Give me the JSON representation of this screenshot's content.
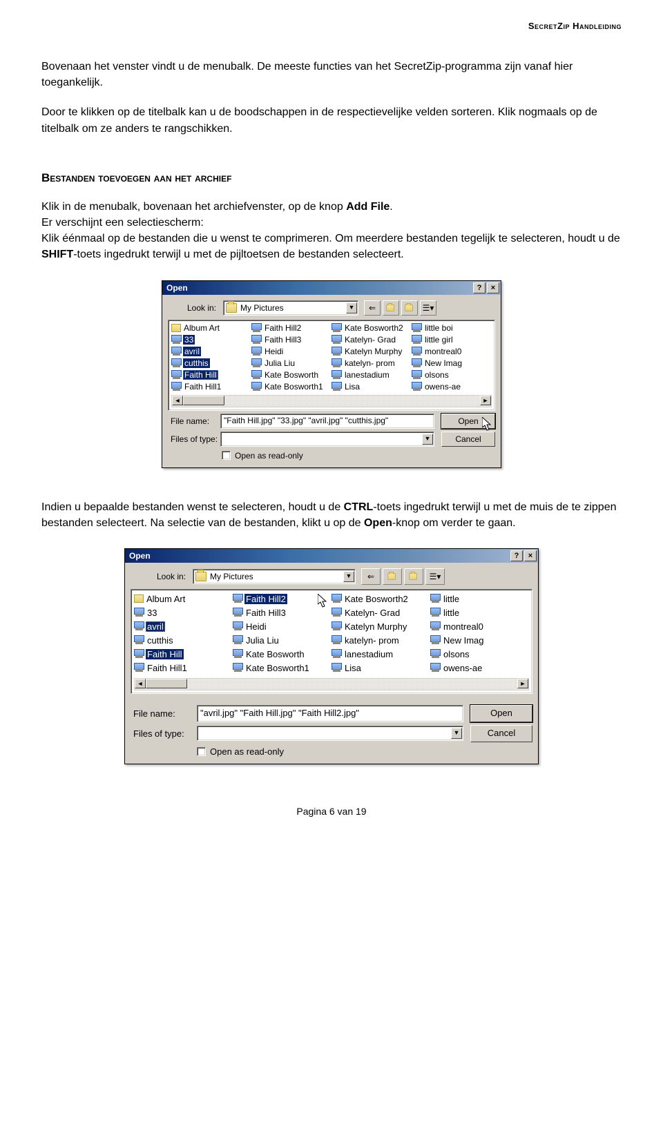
{
  "header": "SecretZip Handleiding",
  "para1": "Bovenaan het venster vindt u de menubalk. De meeste functies van het SecretZip-programma zijn vanaf hier toegankelijk.",
  "para2": "Door te klikken op de titelbalk kan u de boodschappen in de respectievelijke velden sorteren. Klik nogmaals op de titelbalk om ze anders te rangschikken.",
  "section_heading": "Bestanden toevoegen aan het archief",
  "para3_a": "Klik in de menubalk, bovenaan het archiefvenster, op de knop ",
  "para3_b": "Add File",
  "para3_c": ".",
  "para4": "Er verschijnt een selectiescherm:",
  "para5_a": "Klik éénmaal op de bestanden die u wenst te comprimeren. Om meerdere bestanden tegelijk te selecteren, houdt u de ",
  "para5_b": "SHIFT",
  "para5_c": "-toets ingedrukt terwijl u met de pijltoetsen de bestanden selecteert.",
  "para6_a": "Indien u bepaalde bestanden wenst te selecteren, houdt u de ",
  "para6_b": "CTRL",
  "para6_c": "-toets ingedrukt terwijl u met de muis de te zippen bestanden selecteert. Na selectie van de bestanden, klikt u op de ",
  "para6_d": "Open",
  "para6_e": "-knop om verder te gaan.",
  "footer": "Pagina 6 van 19",
  "dialog": {
    "title": "Open",
    "lookin_label": "Look in:",
    "lookin_value": "My Pictures",
    "filename_label": "File name:",
    "filetype_label": "Files of type:",
    "open_btn": "Open",
    "cancel_btn": "Cancel",
    "readonly": "Open as read-only"
  },
  "d1": {
    "filename_value": "\"Faith Hill.jpg\" \"33.jpg\" \"avril.jpg\" \"cutthis.jpg\"",
    "cols": [
      [
        {
          "n": "Album Art",
          "folder": true
        },
        {
          "n": "33",
          "sel": true
        },
        {
          "n": "avril",
          "sel": true
        },
        {
          "n": "cutthis",
          "sel": true
        },
        {
          "n": "Faith Hill",
          "sel": true,
          "dotted": true
        },
        {
          "n": "Faith Hill1"
        }
      ],
      [
        {
          "n": "Faith Hill2"
        },
        {
          "n": "Faith Hill3"
        },
        {
          "n": "Heidi"
        },
        {
          "n": "Julia Liu"
        },
        {
          "n": "Kate Bosworth"
        },
        {
          "n": "Kate Bosworth1"
        }
      ],
      [
        {
          "n": "Kate Bosworth2"
        },
        {
          "n": "Katelyn- Grad"
        },
        {
          "n": "Katelyn Murphy"
        },
        {
          "n": "katelyn- prom"
        },
        {
          "n": "lanestadium"
        },
        {
          "n": "Lisa"
        }
      ],
      [
        {
          "n": "little boi"
        },
        {
          "n": "little girl"
        },
        {
          "n": "montreal0"
        },
        {
          "n": "New Imag"
        },
        {
          "n": "olsons"
        },
        {
          "n": "owens-ae"
        }
      ]
    ]
  },
  "d2": {
    "filename_value": "\"avril.jpg\" \"Faith Hill.jpg\" \"Faith Hill2.jpg\"",
    "cols": [
      [
        {
          "n": "Album Art",
          "folder": true
        },
        {
          "n": "33"
        },
        {
          "n": "avril",
          "sel": true,
          "dotted": true
        },
        {
          "n": "cutthis"
        },
        {
          "n": "Faith Hill",
          "sel": true
        },
        {
          "n": "Faith Hill1"
        }
      ],
      [
        {
          "n": "Faith Hill2",
          "sel": true,
          "cursor": true
        },
        {
          "n": "Faith Hill3"
        },
        {
          "n": "Heidi"
        },
        {
          "n": "Julia Liu"
        },
        {
          "n": "Kate Bosworth"
        },
        {
          "n": "Kate Bosworth1"
        }
      ],
      [
        {
          "n": "Kate Bosworth2"
        },
        {
          "n": "Katelyn- Grad"
        },
        {
          "n": "Katelyn Murphy"
        },
        {
          "n": "katelyn- prom"
        },
        {
          "n": "lanestadium"
        },
        {
          "n": "Lisa"
        }
      ],
      [
        {
          "n": "little"
        },
        {
          "n": "little"
        },
        {
          "n": "montreal0"
        },
        {
          "n": "New Imag"
        },
        {
          "n": "olsons"
        },
        {
          "n": "owens-ae"
        }
      ]
    ]
  }
}
